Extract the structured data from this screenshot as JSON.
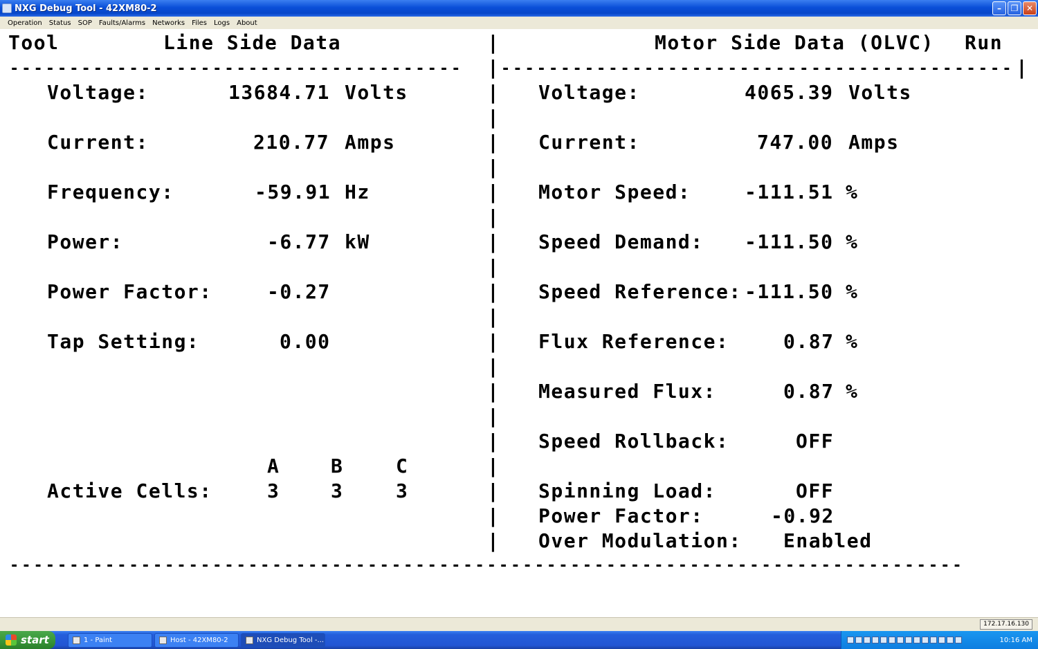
{
  "window": {
    "title": "NXG Debug Tool - 42XM80-2"
  },
  "menu": [
    "Operation",
    "Status",
    "SOP",
    "Faults/Alarms",
    "Networks",
    "Files",
    "Logs",
    "About"
  ],
  "header": {
    "tool": "Tool",
    "line_title": "Line Side Data",
    "motor_title": "Motor Side Data (OLVC)",
    "state": "Run"
  },
  "dash_left": "--------------------------------------",
  "dash_right": "-------------------------------------------",
  "dash_bottom": "--------------------------------------------------------------------------------",
  "bar": "|",
  "line_side": {
    "voltage_label": "Voltage:",
    "voltage_value": "13684.71",
    "voltage_unit": "Volts",
    "current_label": "Current:",
    "current_value": "210.77",
    "current_unit": "Amps",
    "frequency_label": "Frequency:",
    "frequency_value": "-59.91",
    "frequency_unit": "Hz",
    "power_label": "Power:",
    "power_value": "-6.77",
    "power_unit": "kW",
    "pf_label": "Power Factor:",
    "pf_value": "-0.27",
    "tap_label": "Tap Setting:",
    "tap_value": "0.00",
    "cells_label": "Active Cells:",
    "cells_headers": [
      "A",
      "B",
      "C"
    ],
    "cells_values": [
      "3",
      "3",
      "3"
    ]
  },
  "motor_side": {
    "voltage_label": "Voltage:",
    "voltage_value": "4065.39",
    "voltage_unit": "Volts",
    "current_label": "Current:",
    "current_value": "747.00",
    "current_unit": "Amps",
    "speed_label": "Motor Speed:",
    "speed_value": "-111.51",
    "speed_unit": "%",
    "demand_label": "Speed Demand:",
    "demand_value": "-111.50",
    "demand_unit": "%",
    "reference_label": "Speed Reference:",
    "reference_value": "-111.50",
    "reference_unit": "%",
    "flux_ref_label": "Flux Reference:",
    "flux_ref_value": "0.87",
    "flux_ref_unit": "%",
    "flux_meas_label": "Measured Flux:",
    "flux_meas_value": "0.87",
    "flux_meas_unit": "%",
    "rollback_label": "Speed Rollback:",
    "rollback_value": "OFF",
    "spinning_label": "Spinning Load:",
    "spinning_value": "OFF",
    "pf_label": "Power Factor:",
    "pf_value": "-0.92",
    "overmod_label": "Over Modulation:",
    "overmod_value": "Enabled"
  },
  "status": {
    "ip": "172.17.16.130"
  },
  "taskbar": {
    "start": "start",
    "tasks": [
      "1 - Paint",
      "Host - 42XM80-2",
      "NXG Debug Tool -..."
    ],
    "clock": "10:16 AM"
  }
}
